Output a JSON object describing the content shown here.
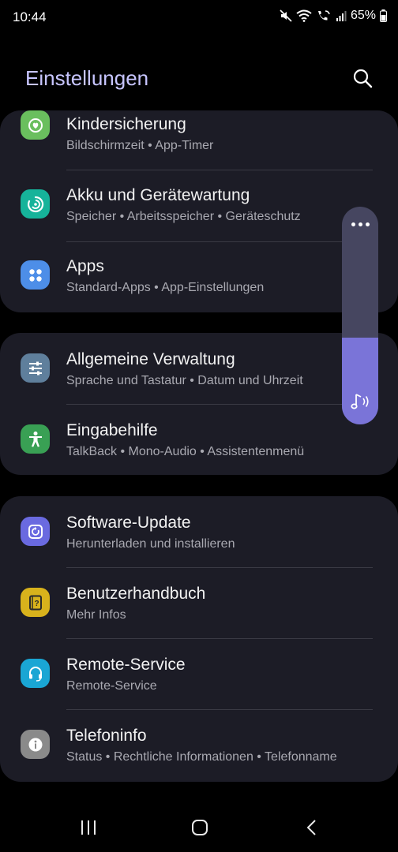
{
  "status_bar": {
    "time": "10:44",
    "battery": "65%",
    "icons": [
      "mute-icon",
      "wifi-icon",
      "wifi-calling-icon",
      "signal-icon",
      "battery-icon"
    ]
  },
  "header": {
    "title": "Einstellungen",
    "search_icon": "search-icon"
  },
  "cards": [
    {
      "items": [
        {
          "title": "Kindersicherung",
          "subtitle": "Bildschirmzeit  •  App-Timer",
          "icon": "digital-wellbeing-icon",
          "color": "#6abf5e"
        },
        {
          "title": "Akku und Gerätewartung",
          "subtitle": "Speicher  •  Arbeitsspeicher  •  Geräteschutz",
          "icon": "device-care-icon",
          "color": "#16b39a"
        },
        {
          "title": "Apps",
          "subtitle": "Standard-Apps  •  App-Einstellungen",
          "icon": "apps-icon",
          "color": "#4d8ee8"
        }
      ]
    },
    {
      "items": [
        {
          "title": "Allgemeine Verwaltung",
          "subtitle": "Sprache und Tastatur  •  Datum und Uhrzeit",
          "icon": "sliders-icon",
          "color": "#5f7f9c"
        },
        {
          "title": "Eingabehilfe",
          "subtitle": "TalkBack  •  Mono-Audio  •  Assistentenmenü",
          "icon": "accessibility-icon",
          "color": "#39a054"
        }
      ]
    },
    {
      "items": [
        {
          "title": "Software-Update",
          "subtitle": "Herunterladen und installieren",
          "icon": "software-update-icon",
          "color": "#6a6ae0"
        },
        {
          "title": "Benutzerhandbuch",
          "subtitle": "Mehr Infos",
          "icon": "user-manual-icon",
          "color": "#d8b21c"
        },
        {
          "title": "Remote-Service",
          "subtitle": "Remote-Service",
          "icon": "headset-icon",
          "color": "#1aa6d4"
        },
        {
          "title": "Telefoninfo",
          "subtitle": "Status  •  Rechtliche Informationen  •  Telefonname",
          "icon": "info-icon",
          "color": "#8a8a8a"
        }
      ]
    }
  ],
  "volume": {
    "level": 0.4,
    "accent": "#7a74d8",
    "icons": [
      "more-icon",
      "media-volume-icon"
    ]
  },
  "nav": [
    "recents-icon",
    "home-icon",
    "back-icon"
  ]
}
